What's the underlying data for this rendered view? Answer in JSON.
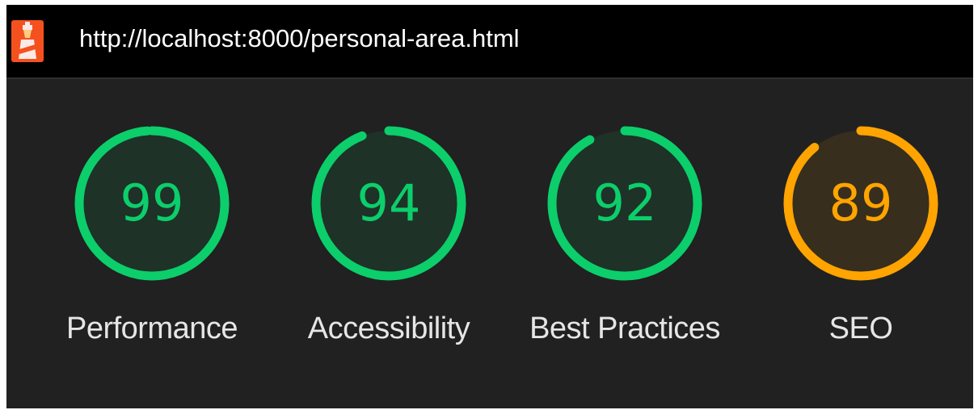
{
  "header": {
    "url": "http://localhost:8000/personal-area.html",
    "logo_icon": "lighthouse-icon"
  },
  "colors": {
    "pass": "#0cce6b",
    "average": "#ffa400",
    "pass_text": "#0cce6b",
    "average_text": "#ffa400"
  },
  "scores": [
    {
      "label": "Performance",
      "value": 99,
      "rating": "pass"
    },
    {
      "label": "Accessibility",
      "value": 94,
      "rating": "pass"
    },
    {
      "label": "Best Practices",
      "value": 92,
      "rating": "pass"
    },
    {
      "label": "SEO",
      "value": 89,
      "rating": "average"
    }
  ]
}
